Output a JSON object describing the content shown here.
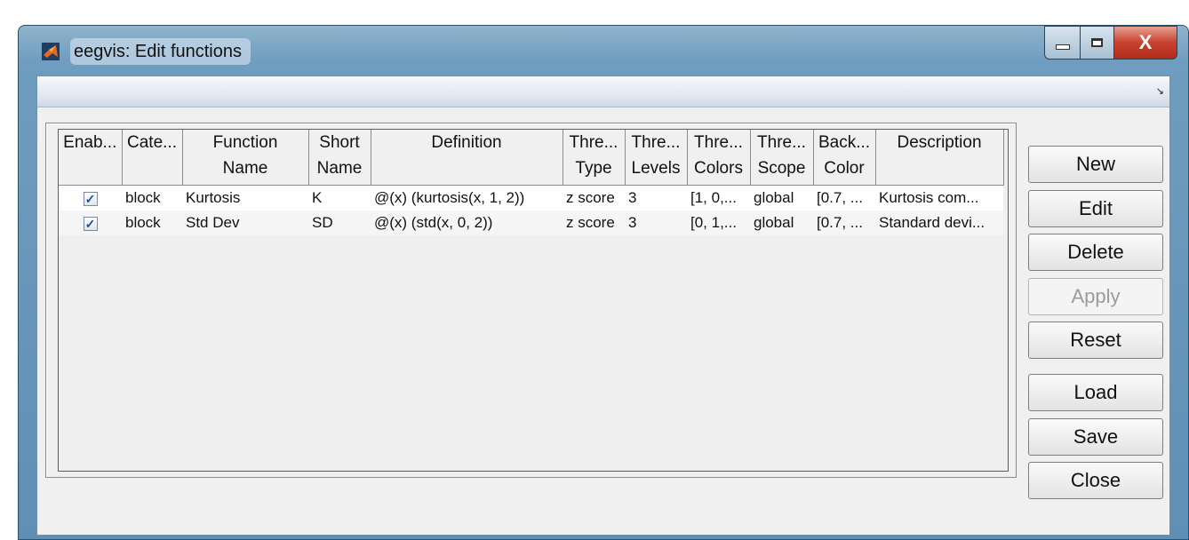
{
  "window": {
    "title": "eegvis: Edit functions",
    "close_glyph": "X",
    "dock_glyph": "↘"
  },
  "table": {
    "columns": [
      [
        "Enab...",
        ""
      ],
      [
        "Cate...",
        ""
      ],
      [
        "Function",
        "Name"
      ],
      [
        "Short",
        "Name"
      ],
      [
        "Definition",
        ""
      ],
      [
        "Thre...",
        "Type"
      ],
      [
        "Thre...",
        "Levels"
      ],
      [
        "Thre...",
        "Colors"
      ],
      [
        "Thre...",
        "Scope"
      ],
      [
        "Back...",
        "Color"
      ],
      [
        "Description",
        ""
      ]
    ],
    "rows": [
      {
        "enabled": "✓",
        "category": "block",
        "function_name": "Kurtosis",
        "short_name": "K",
        "definition": "@(x) (kurtosis(x, 1, 2))",
        "threshold_type": "z score",
        "threshold_levels": "3",
        "threshold_colors": "[1, 0,...",
        "threshold_scope": "global",
        "background_color": "[0.7, ...",
        "description": "Kurtosis com..."
      },
      {
        "enabled": "✓",
        "category": "block",
        "function_name": "Std Dev",
        "short_name": "SD",
        "definition": "@(x) (std(x, 0, 2))",
        "threshold_type": "z score",
        "threshold_levels": "3",
        "threshold_colors": "[0, 1,...",
        "threshold_scope": "global",
        "background_color": "[0.7, ...",
        "description": "Standard devi..."
      }
    ]
  },
  "buttons": {
    "new": "New",
    "edit": "Edit",
    "delete": "Delete",
    "apply": "Apply",
    "reset": "Reset",
    "load": "Load",
    "save": "Save",
    "close": "Close"
  }
}
